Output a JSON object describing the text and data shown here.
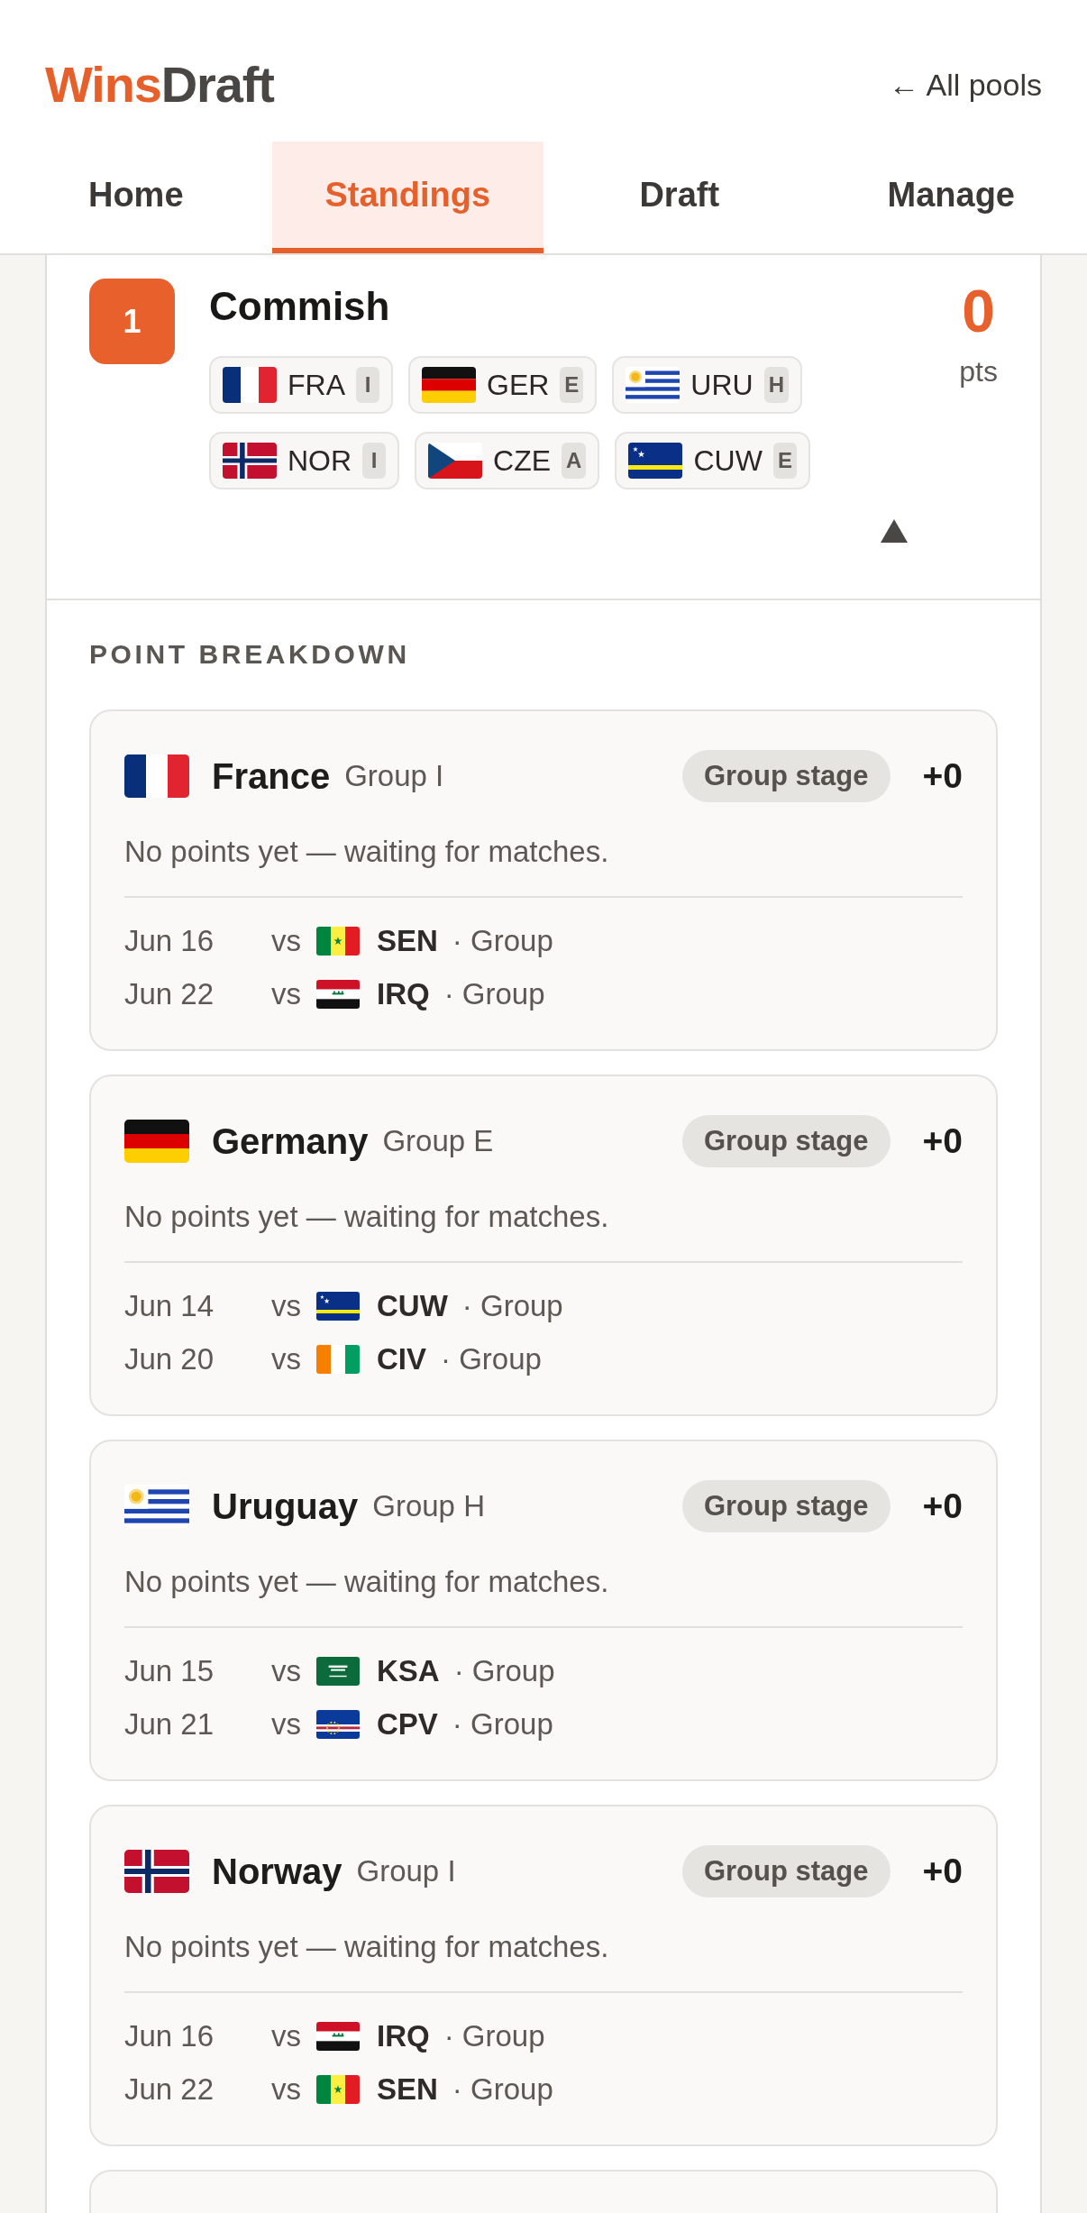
{
  "header": {
    "logo": {
      "accent": "Wins",
      "rest": "Draft"
    },
    "back_link": "← All pools"
  },
  "tabs": [
    {
      "label": "Home",
      "selected": false
    },
    {
      "label": "Standings",
      "selected": true
    },
    {
      "label": "Draft",
      "selected": false
    },
    {
      "label": "Manage",
      "selected": false
    }
  ],
  "standing": {
    "rank": "1",
    "name": "Commish",
    "points": "0",
    "points_unit": "pts",
    "expanded": true,
    "teams": [
      {
        "kind": "france",
        "code": "FRA",
        "group": "I"
      },
      {
        "kind": "germany",
        "code": "GER",
        "group": "E"
      },
      {
        "kind": "uruguay",
        "code": "URU",
        "group": "H"
      },
      {
        "kind": "norway",
        "code": "NOR",
        "group": "I"
      },
      {
        "kind": "czechia",
        "code": "CZE",
        "group": "A"
      },
      {
        "kind": "curacao",
        "code": "CUW",
        "group": "E"
      }
    ]
  },
  "breakdown": {
    "title": "POINT BREAKDOWN",
    "teams": [
      {
        "kind": "france",
        "name": "France",
        "group": "Group I",
        "stage": "Group stage",
        "points": "+0",
        "note": "No points yet — waiting for matches.",
        "matches": [
          {
            "date": "Jun 16",
            "vs": "vs",
            "opponent": {
              "kind": "senegal",
              "code": "SEN"
            },
            "round": "· Group"
          },
          {
            "date": "Jun 22",
            "vs": "vs",
            "opponent": {
              "kind": "iraq",
              "code": "IRQ"
            },
            "round": "· Group"
          }
        ]
      },
      {
        "kind": "germany",
        "name": "Germany",
        "group": "Group E",
        "stage": "Group stage",
        "points": "+0",
        "note": "No points yet — waiting for matches.",
        "matches": [
          {
            "date": "Jun 14",
            "vs": "vs",
            "opponent": {
              "kind": "curacao",
              "code": "CUW"
            },
            "round": "· Group"
          },
          {
            "date": "Jun 20",
            "vs": "vs",
            "opponent": {
              "kind": "ivorycoast",
              "code": "CIV"
            },
            "round": "· Group"
          }
        ]
      },
      {
        "kind": "uruguay",
        "name": "Uruguay",
        "group": "Group H",
        "stage": "Group stage",
        "points": "+0",
        "note": "No points yet — waiting for matches.",
        "matches": [
          {
            "date": "Jun 15",
            "vs": "vs",
            "opponent": {
              "kind": "saudiarabia",
              "code": "KSA"
            },
            "round": "· Group"
          },
          {
            "date": "Jun 21",
            "vs": "vs",
            "opponent": {
              "kind": "capeverde",
              "code": "CPV"
            },
            "round": "· Group"
          }
        ]
      },
      {
        "kind": "norway",
        "name": "Norway",
        "group": "Group I",
        "stage": "Group stage",
        "points": "+0",
        "note": "No points yet — waiting for matches.",
        "matches": [
          {
            "date": "Jun 16",
            "vs": "vs",
            "opponent": {
              "kind": "iraq",
              "code": "IRQ"
            },
            "round": "· Group"
          },
          {
            "date": "Jun 22",
            "vs": "vs",
            "opponent": {
              "kind": "senegal",
              "code": "SEN"
            },
            "round": "· Group"
          }
        ]
      }
    ]
  }
}
